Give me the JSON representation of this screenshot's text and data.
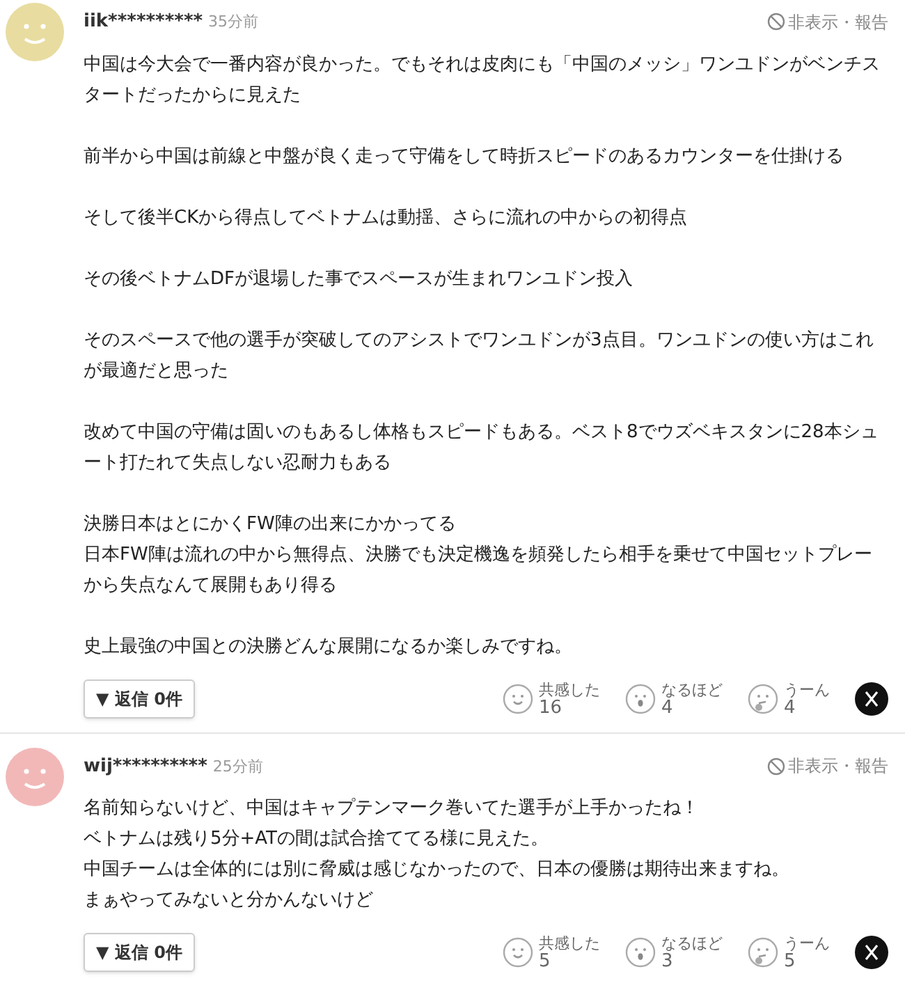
{
  "comments": [
    {
      "color": "#e8dca0",
      "user": "iik**********",
      "time": "35分前",
      "hide_report": "非表示・報告",
      "paragraphs": [
        [
          "中国は今大会で一番内容が良かった。でもそれは皮肉にも「中国のメッシ」ワンユドンがベンチスタートだったからに見えた"
        ],
        [
          "前半から中国は前線と中盤が良く走って守備をして時折スピードのあるカウンターを仕掛ける"
        ],
        [
          "そして後半CKから得点してベトナムは動揺、さらに流れの中からの初得点"
        ],
        [
          "その後ベトナムDFが退場した事でスペースが生まれワンユドン投入"
        ],
        [
          "そのスペースで他の選手が突破してのアシストでワンユドンが3点目。ワンユドンの使い方はこれが最適だと思った"
        ],
        [
          "改めて中国の守備は固いのもあるし体格もスピードもある。ベスト8でウズベキスタンに28本シュート打たれて失点しない忍耐力もある"
        ],
        [
          "決勝日本はとにかくFW陣の出来にかかってる",
          "日本FW陣は流れの中から無得点、決勝でも決定機逸を頻発したら相手を乗せて中国セットプレーから失点なんて展開もあり得る"
        ],
        [
          "史上最強の中国との決勝どんな展開になるか楽しみですね。"
        ]
      ],
      "reply_button": "▼ 返信 0件",
      "reactions": [
        {
          "kind": "smile",
          "label": "共感した",
          "count": "16"
        },
        {
          "kind": "surprised",
          "label": "なるほど",
          "count": "4"
        },
        {
          "kind": "thinking",
          "label": "うーん",
          "count": "4"
        }
      ]
    },
    {
      "color": "#f2b8b8",
      "user": "wij**********",
      "time": "25分前",
      "hide_report": "非表示・報告",
      "paragraphs": [
        [
          "名前知らないけど、中国はキャプテンマーク巻いてた選手が上手かったね！",
          "ベトナムは残り5分+ATの間は試合捨ててる様に見えた。",
          "中国チームは全体的には別に脅威は感じなかったので、日本の優勝は期待出来ますね。",
          "まぁやってみないと分かんないけど"
        ]
      ],
      "reply_button": "▼ 返信 0件",
      "reactions": [
        {
          "kind": "smile",
          "label": "共感した",
          "count": "5"
        },
        {
          "kind": "surprised",
          "label": "なるほど",
          "count": "3"
        },
        {
          "kind": "thinking",
          "label": "うーん",
          "count": "5"
        }
      ]
    }
  ]
}
